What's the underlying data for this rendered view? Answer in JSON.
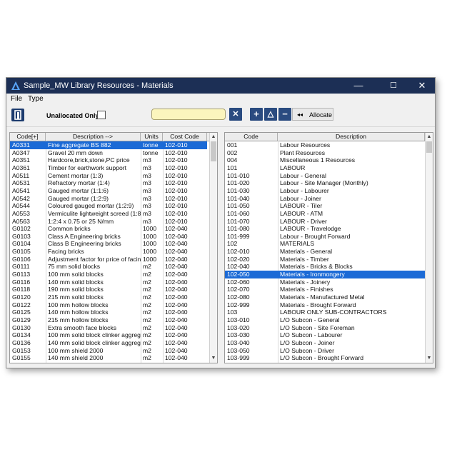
{
  "window": {
    "title": "Sample_MW Library Resources - Materials",
    "minimize": "—",
    "maximize": "☐",
    "close": "✕"
  },
  "menu": [
    "File",
    "Type"
  ],
  "toolbar": {
    "unallocated_label": "Unallocated Only",
    "search_value": "",
    "clear_symbol": "✕",
    "add_symbol": "+",
    "up_symbol": "△",
    "remove_symbol": "−",
    "allocate_arrows": "◂◂",
    "allocate_label": "Allocate"
  },
  "resources": {
    "headers": [
      "Code[+]",
      "Description -->",
      "Units",
      "Cost Code"
    ],
    "selected_index": 0,
    "rows": [
      [
        "A0331",
        "Fine aggregate BS 882",
        "tonne",
        "102-010"
      ],
      [
        "A0347",
        "Gravel 20 mm down",
        "tonne",
        "102-010"
      ],
      [
        "A0351",
        "Hardcore,brick,stone,PC price",
        "m3",
        "102-010"
      ],
      [
        "A0361",
        "Timber for earthwork support",
        "m3",
        "102-010"
      ],
      [
        "A0511",
        "Cement mortar (1:3)",
        "m3",
        "102-010"
      ],
      [
        "A0531",
        "Refractory mortar (1:4)",
        "m3",
        "102-010"
      ],
      [
        "A0541",
        "Gauged mortar (1:1:6)",
        "m3",
        "102-010"
      ],
      [
        "A0542",
        "Gauged mortar (1:2:9)",
        "m3",
        "102-010"
      ],
      [
        "A0544",
        "Coloured gauged mortar (1:2:9)",
        "m3",
        "102-010"
      ],
      [
        "A0553",
        "Vermiculite lightweight screed (1:8)",
        "m3",
        "102-010"
      ],
      [
        "A0563",
        "1:2:4 x 0.75 or 25 N/mm",
        "m3",
        "102-010"
      ],
      [
        "G0102",
        "Common bricks",
        "1000",
        "102-040"
      ],
      [
        "G0103",
        "Class A Engineering bricks",
        "1000",
        "102-040"
      ],
      [
        "G0104",
        "Class B Engineering bricks",
        "1000",
        "102-040"
      ],
      [
        "G0105",
        "Facing bricks",
        "1000",
        "102-040"
      ],
      [
        "G0106",
        "Adjustment factor for price of facin",
        "1000",
        "102-040"
      ],
      [
        "G0111",
        "75 mm solid blocks",
        "m2",
        "102-040"
      ],
      [
        "G0113",
        "100 mm solid blocks",
        "m2",
        "102-040"
      ],
      [
        "G0116",
        "140 mm solid blocks",
        "m2",
        "102-040"
      ],
      [
        "G0118",
        "190 mm solid blocks",
        "m2",
        "102-040"
      ],
      [
        "G0120",
        "215 mm solid blocks",
        "m2",
        "102-040"
      ],
      [
        "G0122",
        "100 mm hollow blocks",
        "m2",
        "102-040"
      ],
      [
        "G0125",
        "140 mm hollow blocks",
        "m2",
        "102-040"
      ],
      [
        "G0129",
        "215 mm hollow blocks",
        "m2",
        "102-040"
      ],
      [
        "G0130",
        "Extra smooth face blocks",
        "m2",
        "102-040"
      ],
      [
        "G0134",
        "100 mm solid block clinker aggregat",
        "m2",
        "102-040"
      ],
      [
        "G0136",
        "140 mm solid block clinker aggregat",
        "m2",
        "102-040"
      ],
      [
        "G0153",
        "100 mm shield 2000",
        "m2",
        "102-040"
      ],
      [
        "G0155",
        "140 mm shield 2000",
        "m2",
        "102-040"
      ]
    ]
  },
  "cost_codes": {
    "headers": [
      "Code",
      "Description"
    ],
    "selected_index": 17,
    "rows": [
      [
        "001",
        "Labour Resources"
      ],
      [
        "002",
        "Plant Resources"
      ],
      [
        "004",
        "Miscellaneous 1 Resources"
      ],
      [
        "101",
        "LABOUR"
      ],
      [
        "101-010",
        "Labour - General"
      ],
      [
        "101-020",
        "Labour - Site Manager (Monthly)"
      ],
      [
        "101-030",
        "Labour - Labourer"
      ],
      [
        "101-040",
        "Labour - Joiner"
      ],
      [
        "101-050",
        "LABOUR - Tiler"
      ],
      [
        "101-060",
        "LABOUR - ATM"
      ],
      [
        "101-070",
        "LABOUR - Driver"
      ],
      [
        "101-080",
        "LABOUR - Travelodge"
      ],
      [
        "101-999",
        "Labour - Brought Forward"
      ],
      [
        "102",
        "MATERIALS"
      ],
      [
        "102-010",
        "Materials - General"
      ],
      [
        "102-020",
        "Materials - Timber"
      ],
      [
        "102-040",
        "Materials - Bricks & Blocks"
      ],
      [
        "102-050",
        "Materials - Ironmongery"
      ],
      [
        "102-060",
        "Materials - Joinery"
      ],
      [
        "102-070",
        "Materials - Finishes"
      ],
      [
        "102-080",
        "Materials - Manufactured Metal"
      ],
      [
        "102-999",
        "Materials - Brought Forward"
      ],
      [
        "103",
        "LABOUR ONLY SUB-CONTRACTORS"
      ],
      [
        "103-010",
        "L/O Subcon - General"
      ],
      [
        "103-020",
        "L/O Subcon - Site Foreman"
      ],
      [
        "103-030",
        "L/O Subcon - Labourer"
      ],
      [
        "103-040",
        "L/O Subcon - Joiner"
      ],
      [
        "103-050",
        "L/O Subcon - Driver"
      ],
      [
        "103-999",
        "L/O Subcon - Brought Forward"
      ]
    ]
  },
  "colors": {
    "titlebar": "#1c2f55",
    "selection": "#1b6ad6",
    "button": "#2a4b80",
    "search_bg": "#fbf5bd"
  },
  "icons": {
    "app": "app-logo-icon",
    "door": "exit-door-icon"
  }
}
